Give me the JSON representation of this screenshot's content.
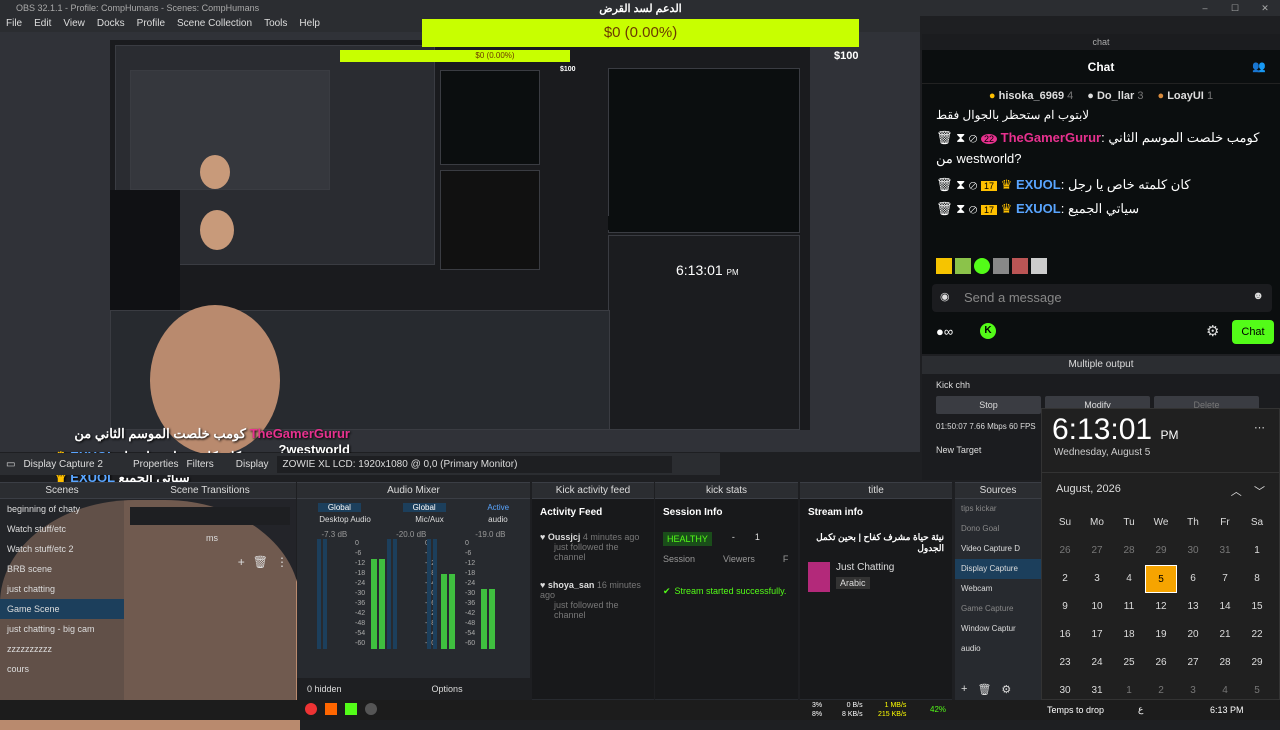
{
  "window_title": "OBS 32.1.1 - Profile: CompHumans - Scenes: CompHumans",
  "menu": [
    "File",
    "Edit",
    "View",
    "Docks",
    "Profile",
    "Scene Collection",
    "Tools",
    "Help"
  ],
  "goal": {
    "title": "الدعم لسد القرض",
    "value": "$0 (0.00%)",
    "max": "$100",
    "mini_value": "$0 (0.00%)",
    "mini_max": "$100"
  },
  "overlay_chat": {
    "line1_user": "TheGamerGurur",
    "line1_text": "كومب خلصت الموسم الثاني من westworld?",
    "line2_user": "EXUOL",
    "line2_text": "كان كلمته خاص يا رجل",
    "line3_user": "EXUOL",
    "line3_text": "سياتي الجميع"
  },
  "source_toolbar": {
    "source": "Display Capture 2",
    "properties": "Properties",
    "filters": "Filters",
    "display_label": "Display",
    "display_value": "ZOWIE XL LCD: 1920x1080 @ 0,0 (Primary Monitor)"
  },
  "chat": {
    "dock_title": "chat",
    "header": "Chat",
    "leaders": [
      {
        "name": "hisoka_6969",
        "count": "4"
      },
      {
        "name": "Do_llar",
        "count": "3"
      },
      {
        "name": "LoayUI",
        "count": "1"
      }
    ],
    "partial": "لابتوب ام ستحظر بالجوال فقط",
    "messages": [
      {
        "badge": "22",
        "user": "TheGamerGurur",
        "text": "كومب خلصت الموسم الثاني من westworld?"
      },
      {
        "badge": "17",
        "user": "EXUOL",
        "text": "كان كلمته خاص يا رجل"
      },
      {
        "badge": "17",
        "user": "EXUOL",
        "text": "سياتي الجميع"
      }
    ],
    "placeholder": "Send a message",
    "send": "Chat"
  },
  "multi_output": {
    "title": "Multiple output",
    "target": "Kick chh",
    "stop": "Stop",
    "modify": "Modify",
    "delete": "Delete",
    "stats": "01:50:07  7.66 Mbps  60 FPS",
    "new_target": "New Target"
  },
  "clock": {
    "time": "6:13:01",
    "ampm": "PM",
    "date": "Wednesday, August 5",
    "month": "August, 2026",
    "weekdays": [
      "Su",
      "Mo",
      "Tu",
      "We",
      "Th",
      "Fr",
      "Sa"
    ],
    "days": [
      "26",
      "27",
      "28",
      "29",
      "30",
      "31",
      "1",
      "2",
      "3",
      "4",
      "5",
      "6",
      "7",
      "8",
      "9",
      "10",
      "11",
      "12",
      "13",
      "14",
      "15",
      "16",
      "17",
      "18",
      "19",
      "20",
      "21",
      "22",
      "23",
      "24",
      "25",
      "26",
      "27",
      "28",
      "29",
      "30",
      "31",
      "1",
      "2",
      "3",
      "4",
      "5"
    ],
    "muted": [
      0,
      1,
      2,
      3,
      4,
      5,
      37,
      38,
      39,
      40,
      41
    ],
    "today_index": 10
  },
  "scenes": {
    "title": "Scenes",
    "items": [
      "beginning of chaty",
      "Watch stuff/etc",
      "Watch stuff/etc 2",
      "BRB scene",
      "just chatting",
      "Game Scene",
      "just chatting - big cam",
      "zzzzzzzzzz",
      "cours"
    ],
    "selected": 5
  },
  "transitions": {
    "title": "Scene Transitions",
    "duration": "ms"
  },
  "mixer": {
    "title": "Audio Mixer",
    "tabs": [
      "Global",
      "Global",
      "Active"
    ],
    "tracks": [
      {
        "name": "Desktop Audio",
        "db": "-7.3 dB"
      },
      {
        "name": "Mic/Aux",
        "db": "-20.0 dB"
      },
      {
        "name": "audio",
        "db": "-19.0 dB"
      }
    ],
    "scale": [
      "0",
      "-6",
      "-12",
      "-18",
      "-24",
      "-30",
      "-36",
      "-42",
      "-48",
      "-54",
      "-60"
    ],
    "hidden": "0 hidden",
    "options": "Options"
  },
  "activity": {
    "title": "Kick activity feed",
    "header": "Activity Feed",
    "items": [
      {
        "user": "Oussjcj",
        "ago": "4 minutes ago",
        "text": "just followed the channel"
      },
      {
        "user": "shoya_san",
        "ago": "16 minutes ago",
        "text": "just followed the channel"
      }
    ]
  },
  "kick_stats": {
    "title": "kick stats",
    "header": "Session Info",
    "healthy": "HEALTHY",
    "session": "Session",
    "viewers": "Viewers",
    "dash": "-",
    "one": "1",
    "f": "F",
    "started": "Stream started successfully."
  },
  "stream_info": {
    "title": "title",
    "header": "Stream info",
    "stream_title": "نيئة حياة مشرف كفاح | بحين تكمل الجدول",
    "category": "Just Chatting",
    "language": "Arabic"
  },
  "sources": {
    "title": "Sources",
    "items": [
      "tips kickar",
      "Dono Goal",
      "Video Capture D",
      "Display Capture",
      "Webcam",
      "Game Capture",
      "Window Captur",
      "audio"
    ],
    "selected": 3
  },
  "taskbar": {
    "tray_net": "0 B/s",
    "tray_net2": "8 KB/s",
    "tray_b1": "1 MB/s",
    "tray_b2": "215 KB/s",
    "pct1": "3%",
    "pct2": "8%",
    "pct3": "42%",
    "drop": "Temps to drop",
    "time": "6:13 PM",
    "lang": "ع"
  }
}
